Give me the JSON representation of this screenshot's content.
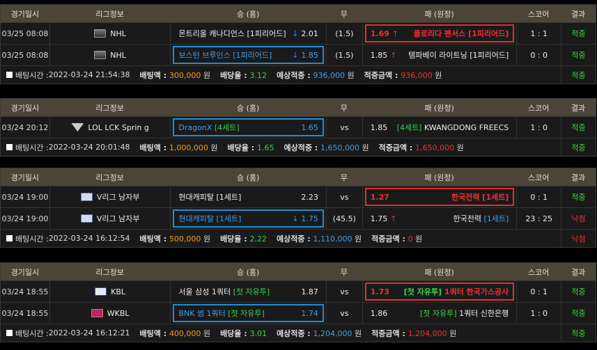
{
  "headers": [
    "경기일시",
    "리그정보",
    "승 (홈)",
    "무",
    "패 (원정)",
    "스코어",
    "결과"
  ],
  "labels": {
    "bet_time": "배팅시간 : ",
    "bet_amount": "배팅액 : ",
    "odds": "배당율 : ",
    "expected": "예상적중 : ",
    "won": "적중금액 : ",
    "won_unit": " 원",
    "vs": "vs"
  },
  "arrows": {
    "down": "↓",
    "up": "↑"
  },
  "bets": [
    {
      "games": [
        {
          "date": "03/25 08:08",
          "league_icon": "nhl-logo-icon",
          "league": "NHL",
          "home": "몬트리올 캐나디언스 [1피리어드]",
          "home_odds": "2.01",
          "home_arrow": "down",
          "draw": "(1.5)",
          "away_odds": "1.69",
          "away_arrow": "up",
          "away": "플로리다 팬서스 [1피리어드]",
          "score": "1 : 1",
          "result": "적중",
          "selected": "away"
        },
        {
          "date": "03/25 08:08",
          "league_icon": "nhl-logo-icon",
          "league": "NHL",
          "home": "보스턴 브루인스 [1피리어드]",
          "home_odds": "1.85",
          "home_arrow": "down",
          "draw": "(1.5)",
          "away_odds": "1.85",
          "away_arrow": "up",
          "away": "템파베이 라이트닝 [1피리어드]",
          "score": "0 : 0",
          "result": "적중",
          "selected": "home"
        }
      ],
      "time": "2022-03-24 21:54:38",
      "amount": "300,000",
      "odds": "3.12",
      "expected": "936,000",
      "won": "936,000",
      "result": "적중"
    },
    {
      "games": [
        {
          "date": "03/24 20:12",
          "league_icon": "lol-logo-icon",
          "league": "LOL LCK Sprin g",
          "home": "DragonX ",
          "home_tag": "[4세트]",
          "home_odds": "1.65",
          "draw": "vs",
          "away_odds": "1.85",
          "away_tag": "[4세트]",
          "away": " KWANGDONG FREECS",
          "score": "1 : 0",
          "result": "적중",
          "selected": "home"
        }
      ],
      "time": "2022-03-24 20:01:48",
      "amount": "1,000,000",
      "odds": "1.65",
      "expected": "1,650,000",
      "won": "1,650,000",
      "result": "적중"
    },
    {
      "games": [
        {
          "date": "03/24 19:00",
          "league_icon": "kovo-logo-icon",
          "league": "V리그 남자부",
          "home": "현대캐피탈 [1세트]",
          "home_odds": "2.23",
          "draw": "vs",
          "away_odds": "1.27",
          "away": "한국전력 [1세트]",
          "score": "0 : 1",
          "result": "적중",
          "selected": "away"
        },
        {
          "date": "03/24 19:00",
          "league_icon": "kovo-logo-icon",
          "league": "V리그 남자부",
          "home": "현대캐피탈 ",
          "home_tag": "[1세트]",
          "home_odds": "1.75",
          "home_arrow": "down",
          "draw": "(45.5)",
          "away_odds": "1.75",
          "away_arrow": "up",
          "away": "한국전력 ",
          "away_tag": "[1세트]",
          "score": "23 : 25",
          "result": "낙첨",
          "selected": "home"
        }
      ],
      "time": "2022-03-24 16:12:54",
      "amount": "500,000",
      "odds": "2.22",
      "expected": "1,110,000",
      "won": "0",
      "result": "낙첨"
    },
    {
      "games": [
        {
          "date": "03/24 18:55",
          "league_icon": "kbl-logo-icon",
          "league": "KBL",
          "home": "서울 삼성 1쿼터 ",
          "home_tag": "[첫 자유투]",
          "home_odds": "1.87",
          "draw": "vs",
          "away_odds": "1.73",
          "away_tag": "[첫 자유투]",
          "away": " 1쿼터 한국가스공사",
          "score": "0 : 1",
          "result": "적중",
          "selected": "away"
        },
        {
          "date": "03/24 18:55",
          "league_icon": "wkbl-logo-icon",
          "league": "WKBL",
          "home": "BNK 썸 1쿼터 ",
          "home_tag": "[첫 자유투]",
          "home_odds": "1.74",
          "draw": "vs",
          "away_odds": "1.86",
          "away_tag": "[첫 자유투]",
          "away": " 1쿼터 신한은행",
          "score": "1 : 0",
          "result": "적중",
          "selected": "home"
        }
      ],
      "time": "2022-03-24 16:12:21",
      "amount": "400,000",
      "odds": "3.01",
      "expected": "1,204,000",
      "won": "1,204,000",
      "result": "적중"
    }
  ],
  "colors": {
    "header_bg": "#4b4538",
    "win": "#39d24a",
    "lose": "#ef3030",
    "tag_green": "#39d24a",
    "tag_blue": "#3aa0f0",
    "select_blue": "#1e8fd6",
    "select_red": "#e03030",
    "amount": "#f59a23"
  }
}
